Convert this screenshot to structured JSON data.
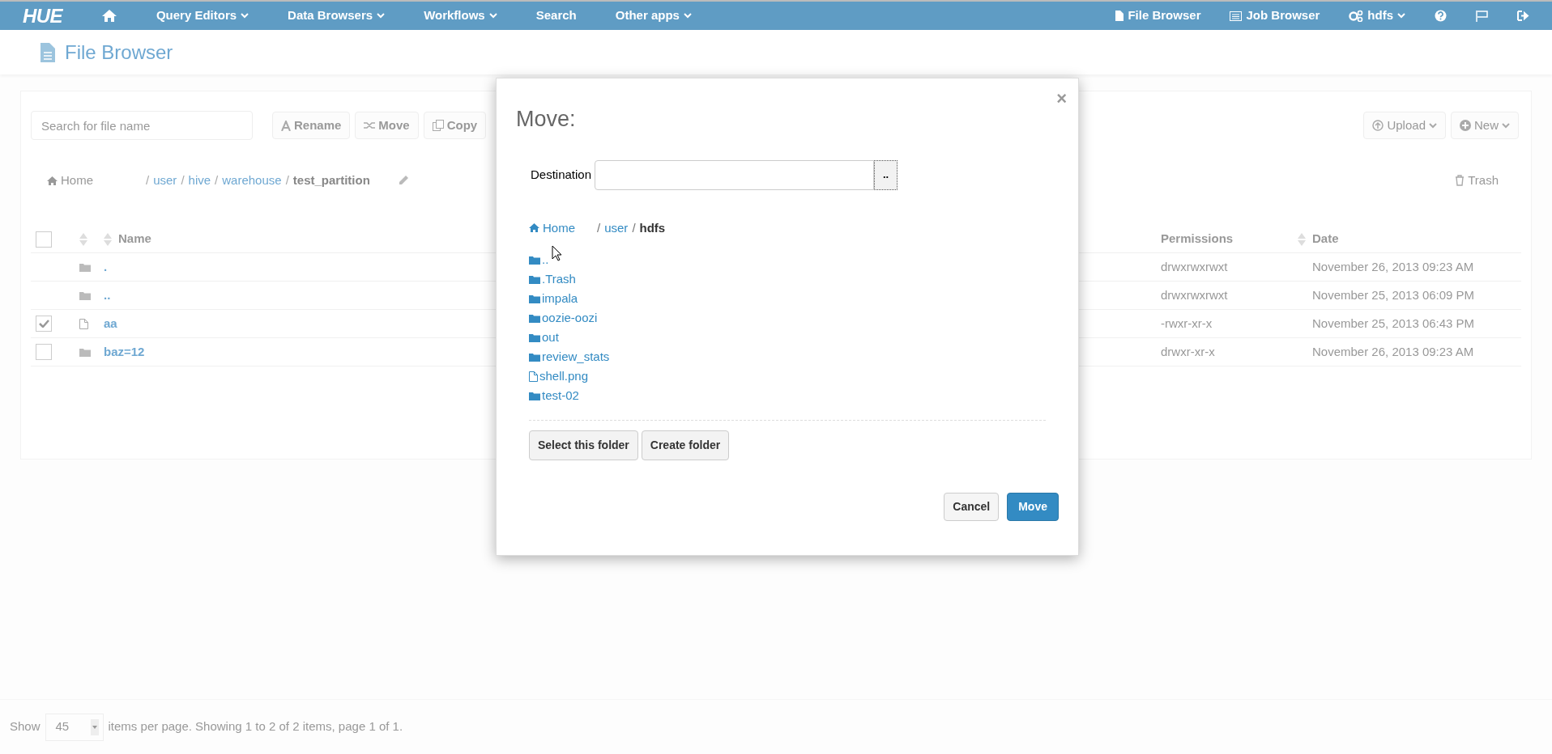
{
  "topbar": {
    "logo": "HUE",
    "nav": [
      {
        "kind": "home"
      },
      {
        "kind": "menu",
        "label": "Query Editors",
        "dropdown": true
      },
      {
        "kind": "menu",
        "label": "Data Browsers",
        "dropdown": true
      },
      {
        "kind": "menu",
        "label": "Workflows",
        "dropdown": true
      },
      {
        "kind": "menu",
        "label": "Search",
        "dropdown": false
      },
      {
        "kind": "menu",
        "label": "Other apps",
        "dropdown": true
      }
    ],
    "right": [
      {
        "kind": "file",
        "label": "File Browser",
        "dropdown": false
      },
      {
        "kind": "list",
        "label": "Job Browser",
        "dropdown": false
      },
      {
        "kind": "gears",
        "label": "hdfs",
        "dropdown": true
      },
      {
        "kind": "help"
      },
      {
        "kind": "flag"
      },
      {
        "kind": "logout"
      }
    ]
  },
  "page_title": "File Browser",
  "toolbar": {
    "search": {
      "placeholder": "Search for file name"
    },
    "actions": [
      {
        "kind": "rename",
        "label": "Rename"
      },
      {
        "kind": "move",
        "label": "Move"
      },
      {
        "kind": "copy",
        "label": "Copy"
      }
    ],
    "right_actions": [
      {
        "kind": "upload",
        "label": "Upload"
      },
      {
        "kind": "new",
        "label": "New"
      }
    ]
  },
  "breadcrumb": {
    "home": "Home",
    "items": [
      {
        "kind": "separator",
        "text": "/"
      },
      {
        "kind": "link",
        "text": "user"
      },
      {
        "kind": "separator",
        "text": "/"
      },
      {
        "kind": "link",
        "text": "hive"
      },
      {
        "kind": "separator",
        "text": "/"
      },
      {
        "kind": "link",
        "text": "warehouse"
      },
      {
        "kind": "separator",
        "text": "/"
      },
      {
        "kind": "current",
        "text": "test_partition"
      }
    ]
  },
  "trash": "Trash",
  "table": {
    "select_all": false,
    "columns": [
      "Name",
      "Permissions",
      "Date"
    ],
    "rows": [
      {
        "kind": "folder",
        "name": ".",
        "permissions": "drwxrwxrwxt",
        "date": "November 26, 2013 09:23 AM"
      },
      {
        "kind": "folder",
        "name": "..",
        "permissions": "drwxrwxrwxt",
        "date": "November 25, 2013 06:09 PM"
      },
      {
        "kind": "file",
        "name": "aa",
        "permissions": "-rwxr-xr-x",
        "date": "November 25, 2013 06:43 PM",
        "checked": true
      },
      {
        "kind": "folder",
        "name": "baz=12",
        "permissions": "drwxr-xr-x",
        "date": "November 26, 2013 09:23 AM",
        "checked": false
      }
    ]
  },
  "footer": {
    "show": "Show",
    "page_size": "45",
    "summary": "items per page. Showing 1 to 2 of 2 items, page 1 of 1."
  },
  "dialog": {
    "title": "Move:",
    "close": "×",
    "destination_label": "Destination",
    "browse_button": "..",
    "breadcrumb": {
      "home": "Home",
      "items": [
        {
          "kind": "separator",
          "text": "/"
        },
        {
          "kind": "link",
          "text": "user"
        },
        {
          "kind": "separator",
          "text": "/"
        },
        {
          "kind": "current",
          "text": "hdfs"
        }
      ]
    },
    "entries": [
      {
        "kind": "folder",
        "name": ".."
      },
      {
        "kind": "folder",
        "name": ".Trash"
      },
      {
        "kind": "folder",
        "name": "impala"
      },
      {
        "kind": "folder",
        "name": "oozie-oozi"
      },
      {
        "kind": "folder",
        "name": "out"
      },
      {
        "kind": "folder",
        "name": "review_stats"
      },
      {
        "kind": "file",
        "name": "shell.png"
      },
      {
        "kind": "folder",
        "name": "test-02"
      }
    ],
    "folder_buttons": [
      "Select this folder",
      "Create folder"
    ],
    "cancel": "Cancel",
    "confirm": "Move"
  }
}
